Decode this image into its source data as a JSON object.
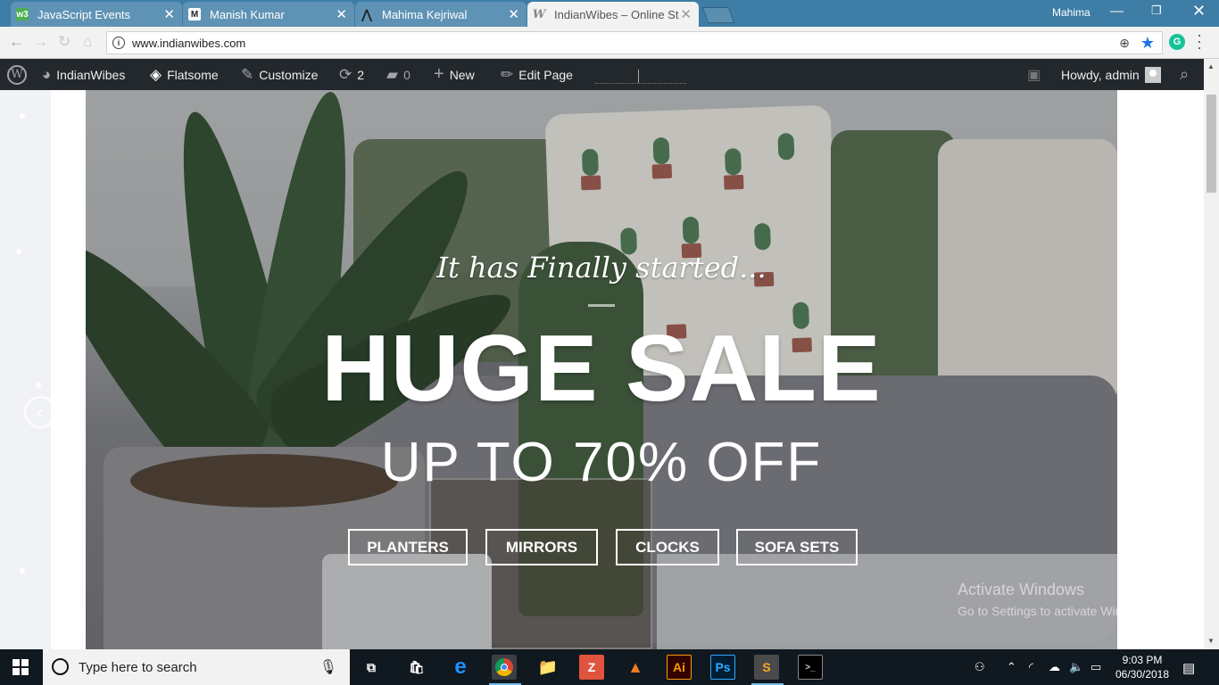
{
  "browser": {
    "tabs": [
      {
        "label": "JavaScript Events",
        "favicon": "w3",
        "active": false
      },
      {
        "label": "Manish Kumar",
        "favicon": "m",
        "active": false
      },
      {
        "label": "Mahima Kejriwal",
        "favicon": "ks",
        "active": false
      },
      {
        "label": "IndianWibes – Online Sto",
        "favicon": "W",
        "active": true
      }
    ],
    "window_user": "Mahima",
    "url": "www.indianwibes.com"
  },
  "wp_admin_bar": {
    "site_name": "IndianWibes",
    "theme": "Flatsome",
    "customize": "Customize",
    "updates_count": "2",
    "comments_count": "0",
    "new_label": "New",
    "edit_page_label": "Edit Page",
    "howdy": "Howdy, admin"
  },
  "hero": {
    "kicker": "It has Finally started...",
    "headline": "HUGE SALE",
    "subheadline": "UP TO 70% OFF",
    "buttons": [
      "PLANTERS",
      "MIRRORS",
      "CLOCKS",
      "SOFA SETS"
    ]
  },
  "watermark": {
    "line1": "Activate Windows",
    "line2": "Go to Settings to activate Windows."
  },
  "taskbar": {
    "search_placeholder": "Type here to search",
    "time": "9:03 PM",
    "date": "06/30/2018"
  },
  "colors": {
    "tabbar": "#3d7da6",
    "wp_bar": "#23282d",
    "taskbar": "#101820",
    "accent": "#1a73e8"
  }
}
